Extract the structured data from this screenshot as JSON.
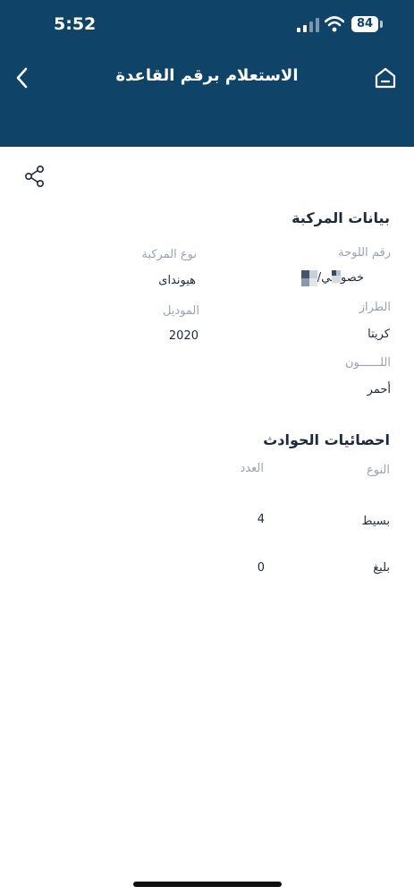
{
  "status_bar": {
    "time": "5:52",
    "battery": "84"
  },
  "header": {
    "title": "الاستعلام برقم القاعدة"
  },
  "vehicle_section": {
    "title": "بيانات المركبة",
    "plate_label": "رقم اللوحة",
    "plate_value": "خصوصي/",
    "vehicle_type_label": "نوع المركبة",
    "vehicle_type_value": "هيونداى",
    "model_label": "الطراز",
    "model_value": "كريتا",
    "year_label": "الموديل",
    "year_value": "2020",
    "color_label": "اللــــــون",
    "color_value": "أحمر"
  },
  "accidents_section": {
    "title": "احصائيات الحوادث",
    "col_type": "النوع",
    "col_count": "العدد",
    "rows": [
      {
        "type": "بسيط",
        "count": "4"
      },
      {
        "type": "بليغ",
        "count": "0"
      }
    ]
  },
  "colors": {
    "header_bg": "#0f4468",
    "text": "#1d2a3a",
    "muted": "#9aa3ad"
  },
  "icons": {
    "back": "chevron-left-icon",
    "home": "home-icon",
    "share": "share-icon"
  }
}
